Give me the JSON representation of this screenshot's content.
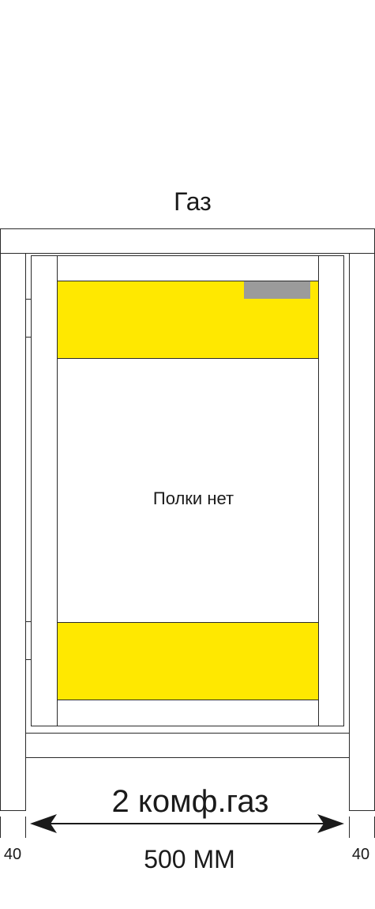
{
  "title": "Газ",
  "shelf_note": "Полки нет",
  "cabinet_label": "2 комф.газ",
  "width_label": "500 ММ",
  "side_left_label": "40",
  "side_right_label": "40",
  "colors": {
    "drawer_fill": "#ffe800",
    "handle_fill": "#9b9b9b",
    "line": "#2a2a2a"
  }
}
